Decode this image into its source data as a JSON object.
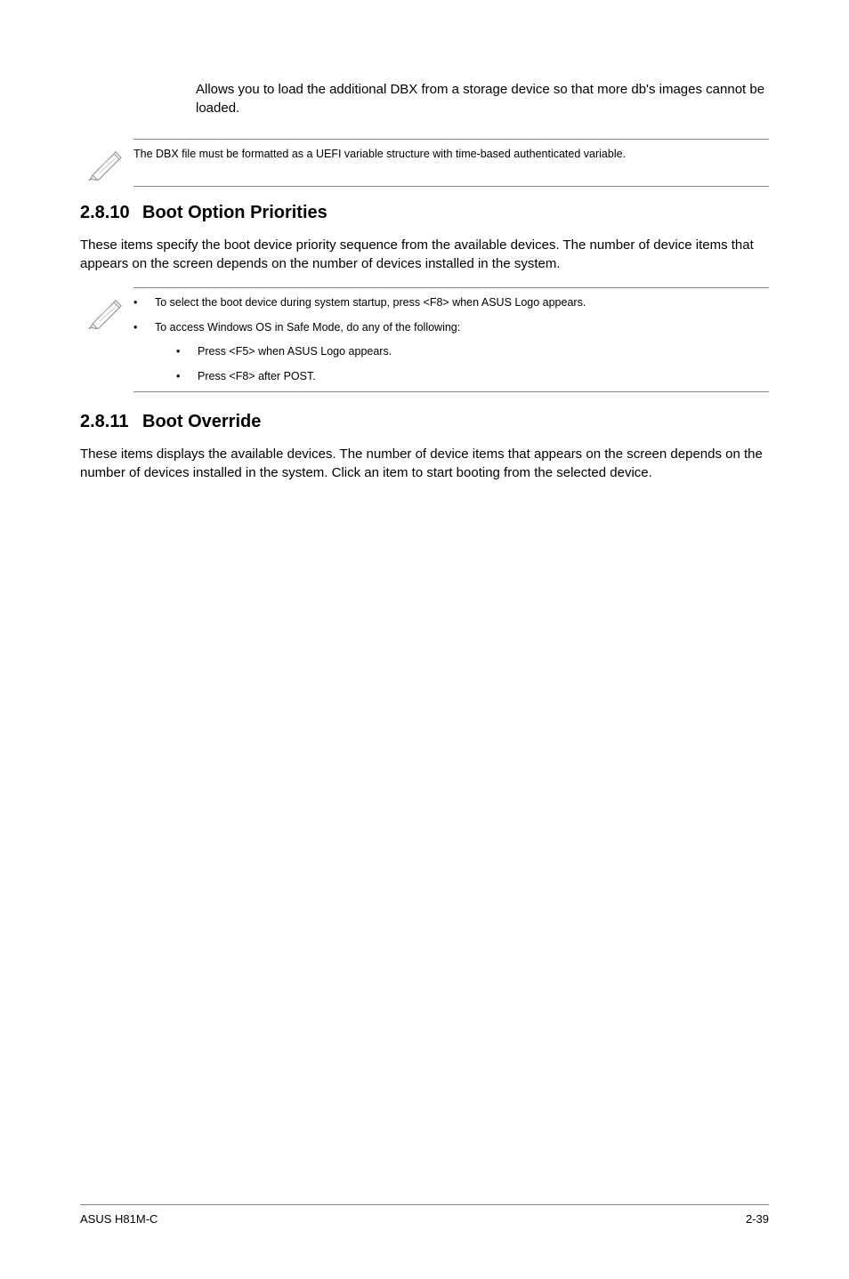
{
  "top_para": "Allows you to load the additional DBX from a storage device so that more db's images cannot be loaded.",
  "note1": "The DBX file must be formatted as a UEFI variable structure with time-based authenticated variable.",
  "section1": {
    "num": "2.8.10",
    "title": "Boot Option Priorities",
    "body": "These items specify the boot device priority sequence from the available devices. The number of device items that appears on the screen depends on the number of devices installed in the system."
  },
  "note2": {
    "bullet1": "To select the boot device during system startup, press <F8> when ASUS Logo appears.",
    "bullet2": "To access Windows OS in Safe Mode, do any of the following:",
    "sub1": "Press <F5> when ASUS Logo appears.",
    "sub2": "Press <F8> after POST."
  },
  "section2": {
    "num": "2.8.11",
    "title": "Boot Override",
    "body": "These items displays the available devices. The number of device items that appears on the screen depends on the number of devices installed in the system. Click an item to start booting from the selected device."
  },
  "footer": {
    "left": "ASUS H81M-C",
    "right": "2-39"
  }
}
